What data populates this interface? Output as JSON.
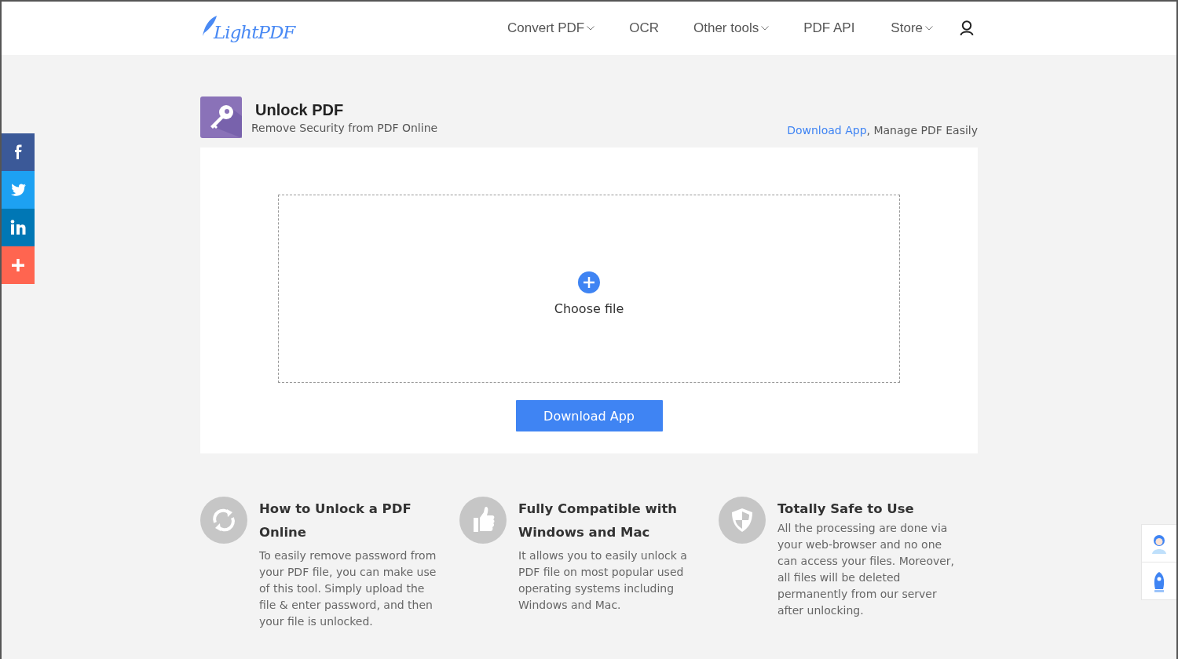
{
  "header": {
    "logo": "LightPDF",
    "nav": [
      {
        "label": "Convert PDF",
        "kind": "dropdown"
      },
      {
        "label": "OCR",
        "kind": "link"
      },
      {
        "label": "Other tools",
        "kind": "dropdown"
      },
      {
        "label": "PDF API",
        "kind": "link"
      },
      {
        "label": "Store",
        "kind": "dropdown"
      }
    ]
  },
  "social": [
    {
      "kind": "facebook",
      "color": "#3b5998"
    },
    {
      "kind": "twitter",
      "color": "#1da1f2"
    },
    {
      "kind": "linkedin",
      "color": "#0077b5"
    },
    {
      "kind": "more",
      "color": "#ff6550"
    }
  ],
  "tool": {
    "title": "Unlock PDF",
    "subtitle": "Remove Security from PDF Online",
    "app_link": "Download App",
    "app_tagline": ", Manage PDF Easily"
  },
  "upload": {
    "label": "Choose file",
    "button": "Download App"
  },
  "features": [
    {
      "kind": "refresh",
      "title": "How to Unlock a PDF Online",
      "text": "To easily remove password from your PDF file, you can make use of this tool. Simply upload the file & enter password, and then your file is unlocked."
    },
    {
      "kind": "thumb",
      "title": "Fully Compatible with Windows and Mac",
      "text": "It allows you to easily unlock a PDF file on most popular used operating systems including Windows and Mac."
    },
    {
      "kind": "shield",
      "title": "Totally Safe to Use",
      "text": "All the processing are done via your web-browser and no one can access your files. Moreover, all files will be deleted permanently from our server after unlocking."
    }
  ]
}
